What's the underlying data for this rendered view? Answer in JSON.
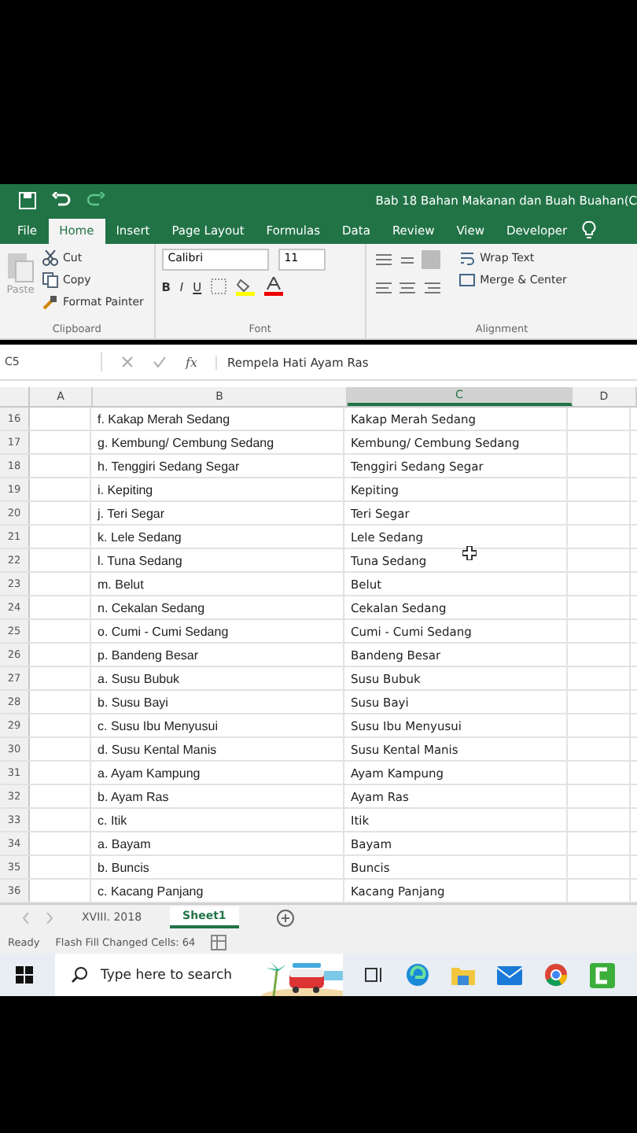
{
  "title_bar": {
    "title": "Bab 18 Bahan Makanan dan Buah Buahan(C"
  },
  "ribbon_tabs": [
    {
      "label": "File",
      "selected": false
    },
    {
      "label": "Home",
      "selected": true
    },
    {
      "label": "Insert",
      "selected": false
    },
    {
      "label": "Page Layout",
      "selected": false
    },
    {
      "label": "Formulas",
      "selected": false
    },
    {
      "label": "Data",
      "selected": false
    },
    {
      "label": "Review",
      "selected": false
    },
    {
      "label": "View",
      "selected": false
    },
    {
      "label": "Developer",
      "selected": false
    }
  ],
  "clipboard": {
    "paste": "Paste",
    "cut": "Cut",
    "copy": "Copy",
    "format_painter": "Format Painter",
    "group": "Clipboard"
  },
  "font": {
    "name": "Calibri",
    "size": "11",
    "bold": "B",
    "italic": "I",
    "underline": "U",
    "group": "Font"
  },
  "alignment": {
    "wrap": "Wrap Text",
    "merge": "Merge & Center",
    "group": "Alignment"
  },
  "formula_bar": {
    "name_box": "C5",
    "fx": "fx",
    "value": "Rempela Hati Ayam Ras"
  },
  "columns": [
    {
      "label": "A",
      "selected": false
    },
    {
      "label": "B",
      "selected": false
    },
    {
      "label": "C",
      "selected": true
    },
    {
      "label": "D",
      "selected": false
    }
  ],
  "rows": [
    {
      "number": "16",
      "b": "f. Kakap Merah Sedang",
      "c": "Kakap Merah Sedang"
    },
    {
      "number": "17",
      "b": "g. Kembung/ Cembung Sedang",
      "c": "Kembung/ Cembung Sedang"
    },
    {
      "number": "18",
      "b": "h. Tenggiri Sedang Segar",
      "c": "Tenggiri Sedang Segar"
    },
    {
      "number": "19",
      "b": "i. Kepiting",
      "c": "Kepiting"
    },
    {
      "number": "20",
      "b": "j. Teri Segar",
      "c": "Teri Segar"
    },
    {
      "number": "21",
      "b": "k. Lele Sedang",
      "c": "Lele Sedang"
    },
    {
      "number": "22",
      "b": "l. Tuna Sedang",
      "c": "Tuna Sedang"
    },
    {
      "number": "23",
      "b": "m. Belut",
      "c": "Belut"
    },
    {
      "number": "24",
      "b": "n. Cekalan Sedang",
      "c": "Cekalan Sedang"
    },
    {
      "number": "25",
      "b": "o. Cumi - Cumi Sedang",
      "c": "Cumi - Cumi Sedang"
    },
    {
      "number": "26",
      "b": "p. Bandeng Besar",
      "c": "Bandeng Besar"
    },
    {
      "number": "27",
      "b": "a. Susu Bubuk",
      "c": "Susu Bubuk"
    },
    {
      "number": "28",
      "b": "b. Susu Bayi",
      "c": "Susu Bayi"
    },
    {
      "number": "29",
      "b": "c. Susu Ibu Menyusui",
      "c": "Susu Ibu Menyusui"
    },
    {
      "number": "30",
      "b": "d. Susu Kental Manis",
      "c": "Susu Kental Manis"
    },
    {
      "number": "31",
      "b": "a. Ayam Kampung",
      "c": "Ayam Kampung"
    },
    {
      "number": "32",
      "b": "b. Ayam Ras",
      "c": "Ayam Ras"
    },
    {
      "number": "33",
      "b": "c. Itik",
      "c": "Itik"
    },
    {
      "number": "34",
      "b": "a. Bayam",
      "c": "Bayam"
    },
    {
      "number": "35",
      "b": "b. Buncis",
      "c": "Buncis"
    },
    {
      "number": "36",
      "b": "c. Kacang Panjang",
      "c": "Kacang Panjang"
    }
  ],
  "sheet_tabs": [
    {
      "label": "XVIII. 2018",
      "selected": false
    },
    {
      "label": "Sheet1",
      "selected": true
    }
  ],
  "status_bar": {
    "ready": "Ready",
    "message": "Flash Fill Changed Cells: 64"
  },
  "taskbar": {
    "search_placeholder": "Type here to search"
  }
}
